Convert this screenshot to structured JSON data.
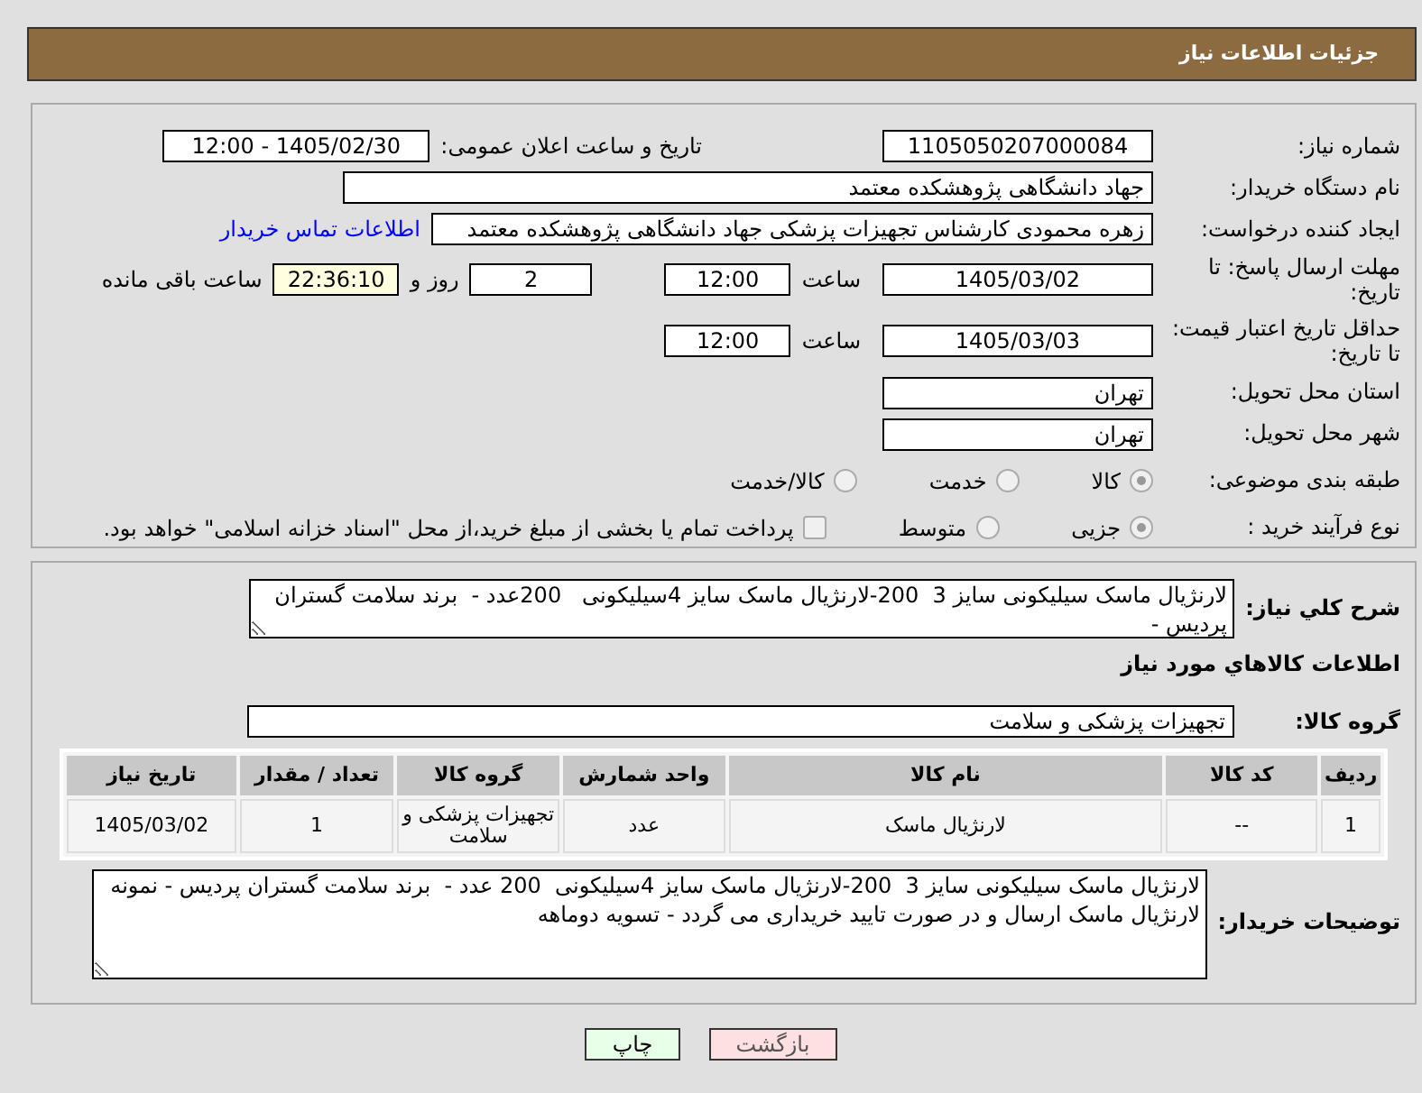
{
  "header": {
    "title": "جزئیات اطلاعات نیاز"
  },
  "need_number": {
    "label": "شماره نیاز:",
    "value": "1105050207000084"
  },
  "announce": {
    "label": "تاریخ و ساعت اعلان عمومی:",
    "value": "1405/02/30 - 12:00"
  },
  "buyer_org": {
    "label": "نام دستگاه خریدار:",
    "value": "جهاد دانشگاهی پژوهشکده معتمد"
  },
  "requester": {
    "label": "ایجاد کننده درخواست:",
    "value": "زهره محمودی کارشناس تجهیزات پزشکی جهاد دانشگاهی پژوهشکده معتمد",
    "link": "اطلاعات تماس خریدار"
  },
  "reply_deadline": {
    "label": "مهلت ارسال پاسخ: تا تاریخ:",
    "date": "1405/03/02",
    "time_label": "ساعت",
    "time": "12:00",
    "days": "2",
    "days_label": "روز و",
    "remaining": "22:36:10",
    "remaining_label": "ساعت باقی مانده"
  },
  "price_validity": {
    "label": "حداقل تاریخ اعتبار قیمت: تا تاریخ:",
    "date": "1405/03/03",
    "time_label": "ساعت",
    "time": "12:00"
  },
  "province": {
    "label": "استان محل تحویل:",
    "value": "تهران"
  },
  "city": {
    "label": "شهر محل تحویل:",
    "value": "تهران"
  },
  "category": {
    "label": "طبقه بندی موضوعی:",
    "options": [
      {
        "label": "کالا",
        "selected": true,
        "disabled": true
      },
      {
        "label": "خدمت",
        "selected": false,
        "disabled": true
      },
      {
        "label": "کالا/خدمت",
        "selected": false,
        "disabled": true
      }
    ]
  },
  "purchase_type": {
    "label": "نوع فرآیند خرید :",
    "options": [
      {
        "label": "جزیی",
        "selected": true,
        "disabled": true
      },
      {
        "label": "متوسط",
        "selected": false,
        "disabled": true
      }
    ],
    "payment_note": {
      "label": "پرداخت تمام یا بخشی از مبلغ خرید،از محل \"اسناد خزانه اسلامی\" خواهد بود.",
      "checked": false,
      "disabled": true
    }
  },
  "description": {
    "label": "شرح کلي نياز:",
    "value": "لارنژیال ماسک سیلیکونی سایز 3  200-لارنژیال ماسک سایز 4سیلیکونی   200عدد -  برند سلامت گستران پردیس -"
  },
  "goods_heading": "اطلاعات کالاهاي مورد نياز",
  "goods_group": {
    "label": "گروه کالا:",
    "value": "تجهیزات پزشکی و سلامت"
  },
  "table": {
    "columns": [
      "ردیف",
      "کد کالا",
      "نام کالا",
      "واحد شمارش",
      "گروه کالا",
      "تعداد / مقدار",
      "تاریخ نیاز"
    ],
    "rows": [
      [
        "1",
        "--",
        "لارنژیال ماسک",
        "عدد",
        "تجهیزات پزشکی و سلامت",
        "1",
        "1405/03/02"
      ]
    ]
  },
  "buyer_notes": {
    "label": "توضیحات خریدار:",
    "value": "لارنژیال ماسک سیلیکونی سایز 3  200-لارنژیال ماسک سایز 4سیلیکونی  200 عدد -  برند سلامت گستران پردیس - نمونه لارنژیال ماسک ارسال و در صورت تایید خریداری می گردد - تسویه دوماهه"
  },
  "buttons": [
    {
      "kind": "back",
      "label": "بازگشت"
    },
    {
      "kind": "print",
      "label": "چاپ"
    }
  ]
}
